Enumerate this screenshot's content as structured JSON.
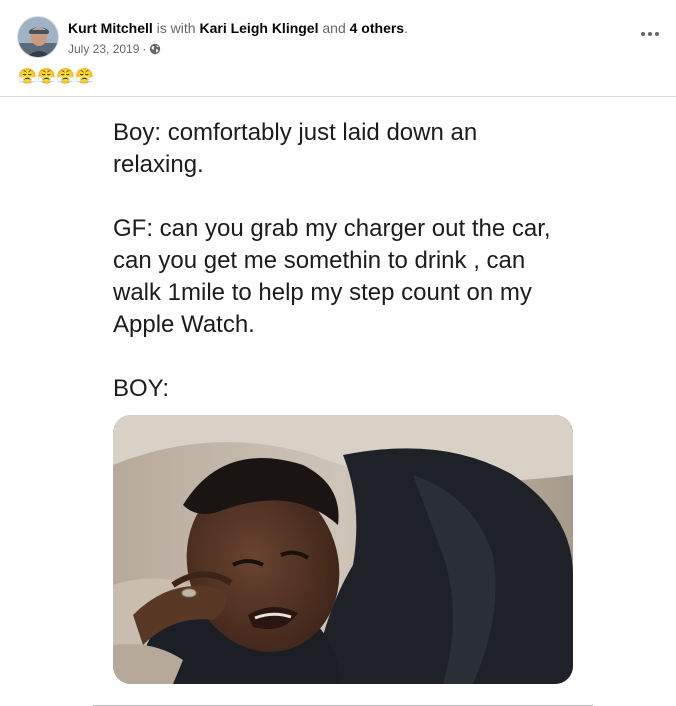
{
  "post": {
    "author": "Kurt Mitchell",
    "with_text": "is with",
    "tagged_person": "Kari Leigh Klingel",
    "and_text": "and",
    "others_link": "4 others",
    "period": ".",
    "date": "July 23, 2019",
    "separator": "·",
    "privacy_icon": "globe-icon",
    "more_icon": "more-options-icon",
    "caption_emojis": [
      "😤",
      "😤",
      "😤",
      "😤"
    ]
  },
  "meme": {
    "text": "Boy: comfortably just laid down an\nrelaxing.\n\nGF: can you grab my charger out the car,\ncan you get me somethin to drink , can\nwalk 1mile to help my step count on my\nApple Watch.\n\nBOY:",
    "image_subject": "crying-man-photo"
  }
}
